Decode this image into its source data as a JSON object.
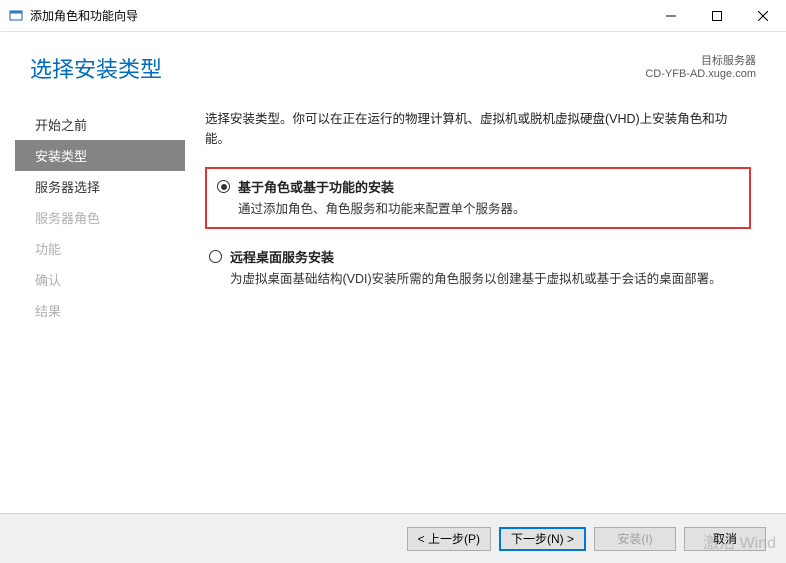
{
  "window": {
    "title": "添加角色和功能向导"
  },
  "header": {
    "page_title": "选择安装类型",
    "server_label": "目标服务器",
    "server_name": "CD-YFB-AD.xuge.com"
  },
  "sidebar": {
    "items": [
      {
        "label": "开始之前",
        "state": "normal"
      },
      {
        "label": "安装类型",
        "state": "active"
      },
      {
        "label": "服务器选择",
        "state": "normal"
      },
      {
        "label": "服务器角色",
        "state": "disabled"
      },
      {
        "label": "功能",
        "state": "disabled"
      },
      {
        "label": "确认",
        "state": "disabled"
      },
      {
        "label": "结果",
        "state": "disabled"
      }
    ]
  },
  "main": {
    "intro": "选择安装类型。你可以在正在运行的物理计算机、虚拟机或脱机虚拟硬盘(VHD)上安装角色和功能。",
    "options": [
      {
        "label": "基于角色或基于功能的安装",
        "desc": "通过添加角色、角色服务和功能来配置单个服务器。",
        "selected": true,
        "highlighted": true
      },
      {
        "label": "远程桌面服务安装",
        "desc": "为虚拟桌面基础结构(VDI)安装所需的角色服务以创建基于虚拟机或基于会话的桌面部署。",
        "selected": false,
        "highlighted": false
      }
    ]
  },
  "footer": {
    "prev": "< 上一步(P)",
    "next": "下一步(N) >",
    "install": "安装(I)",
    "cancel": "取消"
  },
  "watermark": "激活 Wind"
}
